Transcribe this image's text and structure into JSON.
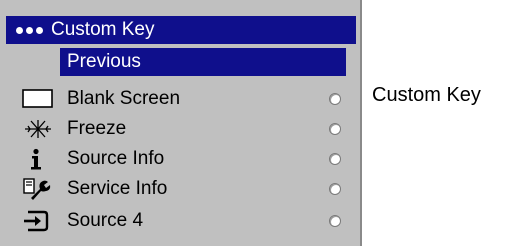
{
  "menu": {
    "title": "Custom Key",
    "selected": "Previous",
    "items": [
      {
        "label": "Blank Screen",
        "icon": "blank-screen-icon"
      },
      {
        "label": "Freeze",
        "icon": "freeze-icon"
      },
      {
        "label": "Source Info",
        "icon": "info-icon"
      },
      {
        "label": "Service Info",
        "icon": "wrench-icon"
      },
      {
        "label": "Source 4",
        "icon": "source-input-icon"
      }
    ]
  },
  "side_label": "Custom Key",
  "colors": {
    "panel": "#c0c0c0",
    "highlight": "#0f0f8c",
    "highlight_text": "#ffffff"
  }
}
